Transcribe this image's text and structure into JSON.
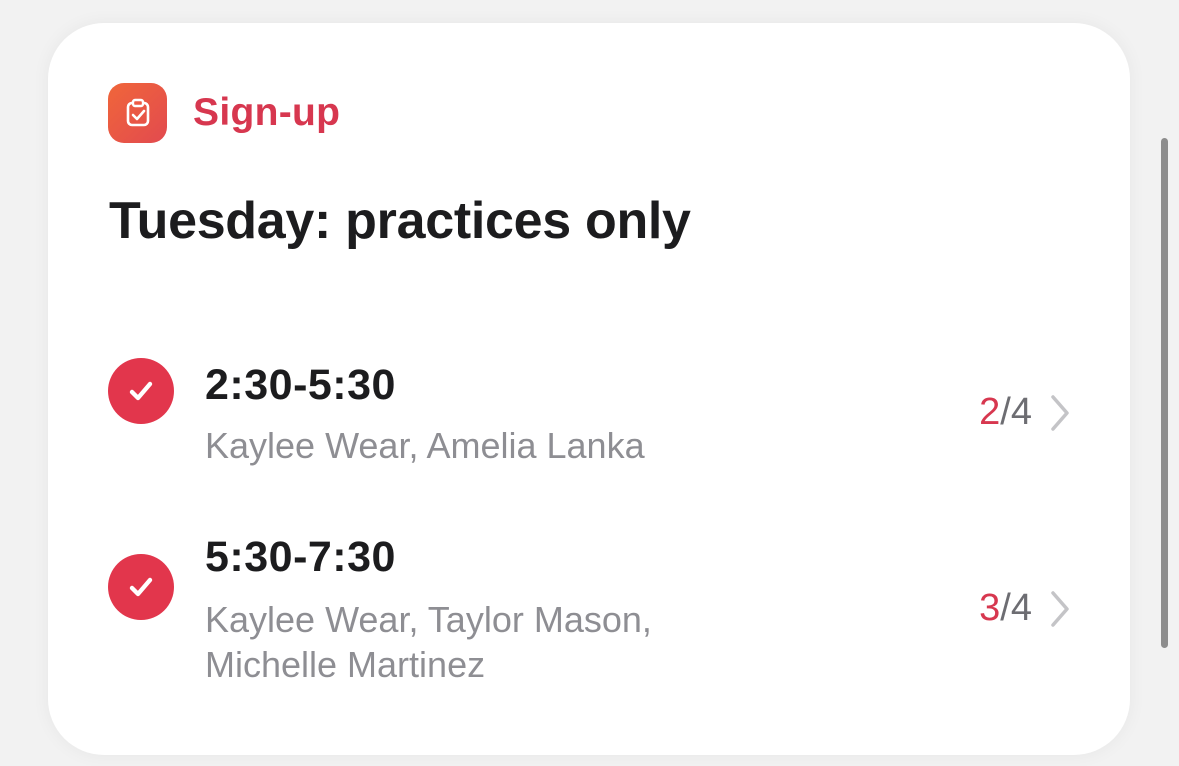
{
  "app": {
    "name": "Sign-up",
    "icon": "clipboard-check-icon",
    "accent_color": "#d7374f"
  },
  "title": "Tuesday: practices only",
  "slots": [
    {
      "time": "2:30-5:30",
      "names": "Kaylee Wear, Amelia Lanka",
      "filled": "2",
      "total": "/4",
      "checked": true
    },
    {
      "time": "5:30-7:30",
      "names": "Kaylee Wear, Taylor Mason, Michelle Martinez",
      "filled": "3",
      "total": "/4",
      "checked": true
    }
  ]
}
